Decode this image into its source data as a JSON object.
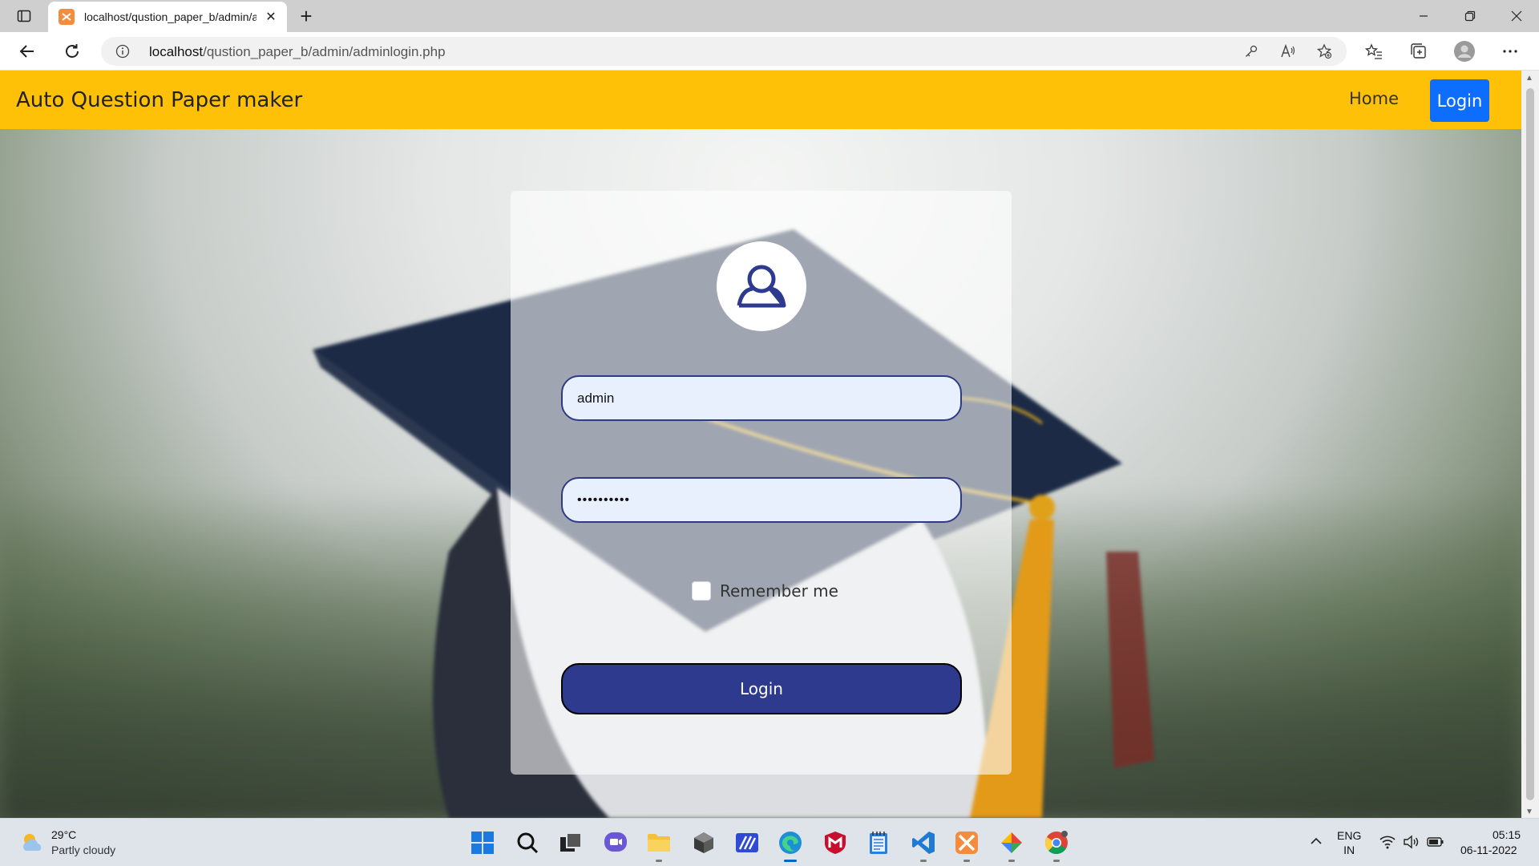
{
  "browser": {
    "tab_title": "localhost/qustion_paper_b/admin/adminlogin.php",
    "tab_icon": "xampp-icon",
    "url_host": "localhost",
    "url_path": "/qustion_paper_b/admin/adminlogin.php"
  },
  "navbar": {
    "brand": "Auto Question Paper maker",
    "home_label": "Home",
    "login_label": "Login",
    "bg_color": "#ffc107",
    "login_color": "#0d6efd"
  },
  "login_form": {
    "avatar_icon": "user-icon",
    "username_value": "admin",
    "password_value": "••••••••••",
    "remember_label": "Remember me",
    "remember_checked": false,
    "submit_label": "Login",
    "submit_color": "#2d3a8e"
  },
  "taskbar": {
    "weather_temp": "29°C",
    "weather_desc": "Partly cloudy",
    "apps": [
      "start-icon",
      "search-icon",
      "task-view-icon",
      "chat-icon",
      "file-explorer-icon",
      "app-cube-icon",
      "sticky-app-icon",
      "edge-icon",
      "mcafee-icon",
      "notepad-icon",
      "vscode-icon",
      "xampp-icon",
      "android-studio-icon",
      "chrome-icon"
    ],
    "lang_line1": "ENG",
    "lang_line2": "IN",
    "time": "05:15",
    "date": "06-11-2022"
  }
}
